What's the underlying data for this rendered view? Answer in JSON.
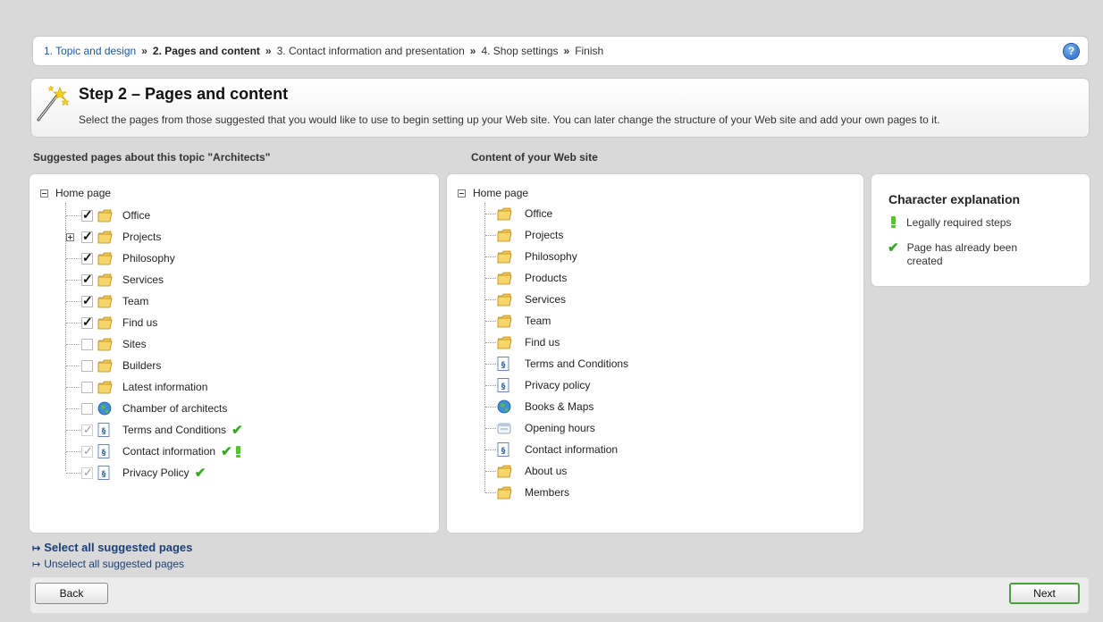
{
  "breadcrumb": {
    "step1": "1. Topic and design",
    "step2": "2. Pages and content",
    "step3": "3. Contact information and presentation",
    "step4": "4. Shop settings",
    "step5": "Finish",
    "separator": "»",
    "help_icon": "question-icon"
  },
  "step": {
    "title": "Step 2 – Pages and content",
    "description": "Select the pages from those suggested that you would like to use to begin setting up your Web site. You can later change the structure of your Web site and add your own pages to it."
  },
  "suggested": {
    "heading": "Suggested pages about this topic \"Architects\"",
    "root": "Home page",
    "items": [
      {
        "label": "Office",
        "state": "checked",
        "icon": "folder-icon"
      },
      {
        "label": "Projects",
        "state": "checked",
        "icon": "folder-icon",
        "expandable": true
      },
      {
        "label": "Philosophy",
        "state": "checked",
        "icon": "folder-icon"
      },
      {
        "label": "Services",
        "state": "checked",
        "icon": "folder-icon"
      },
      {
        "label": "Team",
        "state": "checked",
        "icon": "folder-icon"
      },
      {
        "label": "Find us",
        "state": "checked",
        "icon": "folder-icon"
      },
      {
        "label": "Sites",
        "state": "unchecked",
        "icon": "folder-icon"
      },
      {
        "label": "Builders",
        "state": "unchecked",
        "icon": "folder-icon"
      },
      {
        "label": "Latest information",
        "state": "unchecked",
        "icon": "folder-icon"
      },
      {
        "label": "Chamber of architects",
        "state": "unchecked",
        "icon": "globe-icon"
      },
      {
        "label": "Terms and Conditions",
        "state": "disabled",
        "icon": "document-icon",
        "created": true
      },
      {
        "label": "Contact information",
        "state": "disabled",
        "icon": "document-icon",
        "created": true,
        "required": true
      },
      {
        "label": "Privacy Policy",
        "state": "disabled",
        "icon": "document-icon",
        "created": true
      }
    ]
  },
  "content": {
    "heading": "Content of your Web site",
    "root": "Home page",
    "items": [
      {
        "label": "Office",
        "icon": "folder-icon"
      },
      {
        "label": "Projects",
        "icon": "folder-icon"
      },
      {
        "label": "Philosophy",
        "icon": "folder-icon"
      },
      {
        "label": "Products",
        "icon": "folder-icon"
      },
      {
        "label": "Services",
        "icon": "folder-icon"
      },
      {
        "label": "Team",
        "icon": "folder-icon"
      },
      {
        "label": "Find us",
        "icon": "folder-icon"
      },
      {
        "label": "Terms and Conditions",
        "icon": "document-icon"
      },
      {
        "label": "Privacy policy",
        "icon": "document-icon"
      },
      {
        "label": "Books & Maps",
        "icon": "globe-icon"
      },
      {
        "label": "Opening hours",
        "icon": "calendar-icon"
      },
      {
        "label": "Contact information",
        "icon": "document-icon"
      },
      {
        "label": "About us",
        "icon": "folder-icon"
      },
      {
        "label": "Members",
        "icon": "folder-icon"
      }
    ]
  },
  "legend": {
    "title": "Character explanation",
    "required": "Legally required steps",
    "created": "Page has already been created"
  },
  "links": {
    "select_all": "Select all suggested pages",
    "unselect_all": "Unselect all suggested pages"
  },
  "buttons": {
    "back": "Back",
    "next": "Next"
  },
  "colors": {
    "link": "#1a5aa6",
    "check_green": "#33aa22",
    "next_border": "#4aa33a"
  }
}
